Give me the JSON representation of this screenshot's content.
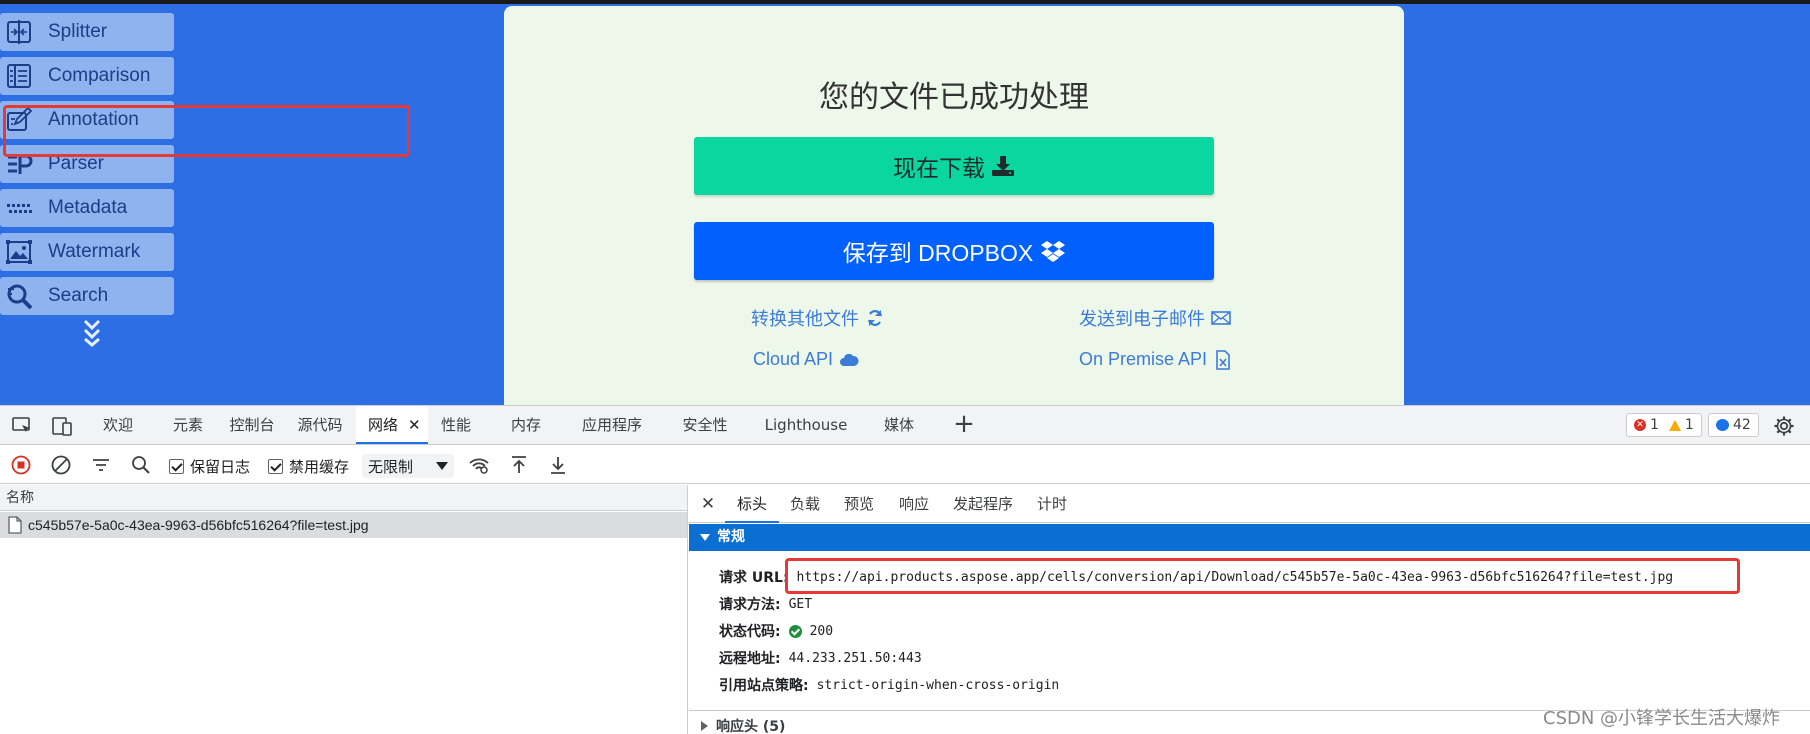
{
  "sidebar": {
    "items": [
      {
        "label": "Splitter",
        "icon": "splitter-icon"
      },
      {
        "label": "Comparison",
        "icon": "comparison-icon"
      },
      {
        "label": "Annotation",
        "icon": "annotation-icon"
      },
      {
        "label": "Parser",
        "icon": "parser-icon"
      },
      {
        "label": "Metadata",
        "icon": "metadata-icon"
      },
      {
        "label": "Watermark",
        "icon": "watermark-icon"
      },
      {
        "label": "Search",
        "icon": "search-icon"
      }
    ]
  },
  "card": {
    "title": "您的文件已成功处理",
    "download_label": "现在下载",
    "dropbox_label": "保存到 DROPBOX",
    "links": {
      "convert_other": "转换其他文件",
      "send_email": "发送到电子邮件",
      "cloud_api": "Cloud API",
      "on_premise": "On Premise API"
    }
  },
  "devtools": {
    "tabs": [
      "欢迎",
      "元素",
      "控制台",
      "源代码",
      "网络",
      "性能",
      "内存",
      "应用程序",
      "安全性",
      "Lighthouse",
      "媒体"
    ],
    "active_tab": "网络",
    "counters": {
      "errors": "1",
      "warnings": "1",
      "messages": "42"
    },
    "toolbar": {
      "preserve_log": "保留日志",
      "disable_cache": "禁用缓存",
      "throttle": "无限制"
    },
    "left": {
      "column_name": "名称",
      "request": "c545b57e-5a0c-43ea-9963-d56bfc516264?file=test.jpg"
    },
    "detail_tabs": [
      "标头",
      "负载",
      "预览",
      "响应",
      "发起程序",
      "计时"
    ],
    "general": {
      "title": "常规",
      "request_url_label": "请求 URL:",
      "request_url": "https://api.products.aspose.app/cells/conversion/api/Download/c545b57e-5a0c-43ea-9963-d56bfc516264?file=test.jpg",
      "method_label": "请求方法:",
      "method": "GET",
      "status_label": "状态代码:",
      "status": "200",
      "remote_label": "远程地址:",
      "remote": "44.233.251.50:443",
      "referrer_label": "引用站点策略:",
      "referrer": "strict-origin-when-cross-origin"
    },
    "response_headers": "响应头 (5)"
  },
  "watermark": "CSDN @小锋学长生活大爆炸",
  "colors": {
    "page_bg": "#2d6ee4",
    "download_btn": "#0ad7a0",
    "dropbox_btn": "#0261fe",
    "general_header": "#0b6fd1",
    "highlight_box": "#e53935"
  }
}
